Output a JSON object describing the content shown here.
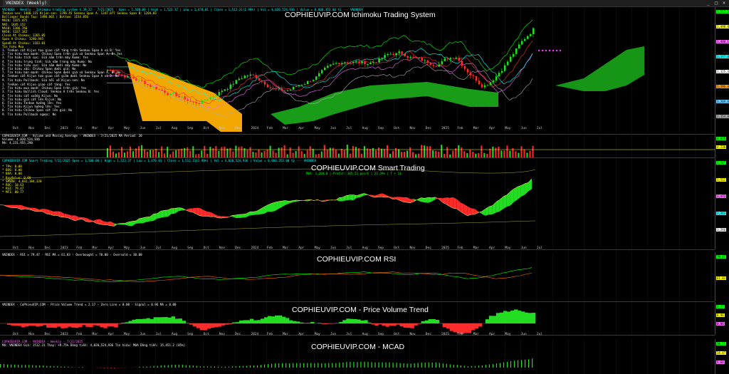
{
  "window": {
    "tab_title": "VNINDEX (Weekly)",
    "controls": [
      "_",
      "□",
      "✕"
    ]
  },
  "colors": {
    "up": "#22dd22",
    "down": "#ff2a2a",
    "cloud_green": "#1aa51a",
    "cloud_orange": "#ffb000",
    "text_yellow": "#ffff00",
    "text_cyan": "#00ffff",
    "text_green": "#00ff00"
  },
  "panes": {
    "ichimoku": {
      "watermark": "COPHIEUVIP.COM Ichimoku Trading System",
      "header": "VNINDEX - Weekly - Ichimoku trading system 4.39.32 - 7/21/2025 - Open = 1,500.00 | High = 1,523.37 | Low = 1,470.01 | Close = 1,512.31(1.98%) | Vol = 4,020,524,936 | Value = 8,000,353.00 tỷ --- VNINDEX",
      "values": [
        "Tenkan-sen: 1400.115   Kijun-sen: 1296.45   Senkou Span A: 1347.077   Senkou Span B: 1204.03",
        "Bollinger Bands Top: 1490.865 | Bottom: 1154.856",
        "MA20: 1325.475",
        "MA5: 1445.152",
        "MA10: 1386.766",
        "MA50: 1337.342",
        "Close At Chikou: 1265.05",
        "Span A Chikou: 1240.945",
        "SpanB At Chikou: 1163.01",
        "Tín hiệu Mua"
      ],
      "signals": [
        "1. Tenkan cắt Kijun tạo giao cắt tăng trên Senkou Span A và B: Yes",
        "2. Tín hiệu mua mạnh: Chikou Span trên giá và Senkou Span A, B: Yes",
        "3. Tín hiệu tích cực: Giá nằm trên mây Kumo: Yes",
        "4. Tín hiệu trung tính: Giá nằm trong mây Kumo: No",
        "5. Tín hiệu tiêu cực: Giá nằm dưới mây Kumo: No",
        "6. Tín hiệu xấu: Chikou Span dưới giá: No",
        "7. Tín hiệu bán mạnh: Chikou Span dưới giá và Senkou Span A, B: No",
        "8. Tenkan cắt Kijun tạo giao cắt giảm dưới Senkou Span A và B: No",
        "9. Tín hiệu Pullback: Giá hồi về Kijun-sen: No"
      ],
      "signals2": [
        "1. Tenkan cắt Kijun giao cắt tăng: Yes",
        "2. Tín hiệu mua mạnh: Chikou Span trên giá: Yes",
        "3. Tín hiệu Bullish Cloud: Senkou A trên Senkou B: Yes",
        "4. Tín hiệu cắt xuống Kijun: No",
        "5. Tín hiệu giá cắt lên Kijun: No",
        "6. Tín hiệu Tenkan hướng lên: Yes",
        "7. Tín hiệu Kijun hướng lên: Yes",
        "8. Tín hiệu Chikou Span cắt lên giá: No",
        "9. Tín hiệu Pullback ngược: No"
      ],
      "scale": [
        "1,512.31",
        "1,490.86",
        "1,400.12",
        "1,347.08",
        "1,325.48",
        "1,296.45",
        "1,204.03",
        "1,154.86"
      ]
    },
    "volume": {
      "header": "COPHIEUVIP.COM - Volume and Moving Average - VNINDEX - 7/21/2025 MA Period: 20",
      "line2": "Volume: 4,020,524,936",
      "line3": "MA: 4,231,955,290",
      "scale": [
        "4.02B",
        "4.23B"
      ]
    },
    "smart": {
      "watermark": "COPHIEUVIP.COM Smart Trading",
      "subtitle": "MUA: 1,280.0 | Profit: 365.51 point | 21.39% | T + 11",
      "header": "COPHIEUVIP.COM Smart Trading  7/21/2025  Open = 1,500.00 | High = 1,523.37 | Low = 1,470.01 | Close = 1,512.31(1.98%) | Vol = 4,020,524,936 | Value = 8,000,353.00 tỷ --- VNINDEX",
      "values": [
        "* TP%: 0.00",
        "* BOS: 0.00",
        "* BOA: 0.00",
        "* BuyValue: 0.00",
        "* SMVDV: 4,832,184,320",
        "* ROC: 18.63",
        "* RSI: 79.47",
        "* MFI: 80.77"
      ],
      "scale": [
        "1,547",
        "1,512",
        "1,472",
        "1,362",
        "1,266"
      ]
    },
    "rsi": {
      "watermark": "COPHIEUVIP.COM RSI",
      "header": "VNINDEX - RSI = 79.47 - RSI MA = 61.83 - Overbought = 70.00 - Oversold = 30.00",
      "scale": [
        "79.47",
        "61.83"
      ]
    },
    "pvt": {
      "watermark": "COPHIEUVIP.COM - Price Volume Trend",
      "header": "VNINDEX - CoPhieuVIP.COM - Price Volume Trend = 2.17 - Zero Line = 0.00 - Signal = 0.96 MA = 0.00",
      "scale": [
        "2.17",
        "0.96",
        "0.00"
      ]
    },
    "macd": {
      "watermark": "COPHIEUVIP.COM - MCAD",
      "header": "COPHIEUVIP.COM - VNINDEX - Weekly - 7/21/2025",
      "line2": "Mã: VNINDEX   Giá: 1512.31   Thay: +9.75%   Dòng tiền: 4,020,524,936   Tín hiệu: MUA   Dòng tiền: 15,451.2 (85%)",
      "scale": [
        "30.11",
        "24.47",
        "5.64"
      ]
    }
  },
  "timeaxis": {
    "upper": [
      "Oct",
      "Nov",
      "Dec",
      "2023",
      "Feb",
      "Mar",
      "Apr",
      "May",
      "Jun",
      "Jul",
      "Aug",
      "Sep",
      "Oct",
      "Nov",
      "Dec",
      "2024",
      "Feb",
      "Mar",
      "Apr",
      "May",
      "Jun",
      "Jul",
      "Aug",
      "Sep",
      "Oct",
      "Nov",
      "Dec",
      "2025",
      "Feb",
      "Mar",
      "Apr",
      "May",
      "Jun",
      "Jul"
    ],
    "lower": [
      "Oct",
      "Nov",
      "Dec",
      "2023",
      "Feb",
      "Mar",
      "Apr",
      "May",
      "Jun",
      "Jul",
      "Aug",
      "Sep",
      "Oct",
      "Nov",
      "Dec",
      "2024",
      "Feb",
      "Mar",
      "Apr",
      "May",
      "Jun",
      "Jul",
      "Aug",
      "Sep",
      "Oct",
      "Nov",
      "Dec",
      "2025",
      "Feb",
      "Mar",
      "Apr",
      "May",
      "Jun",
      "Jul"
    ]
  }
}
